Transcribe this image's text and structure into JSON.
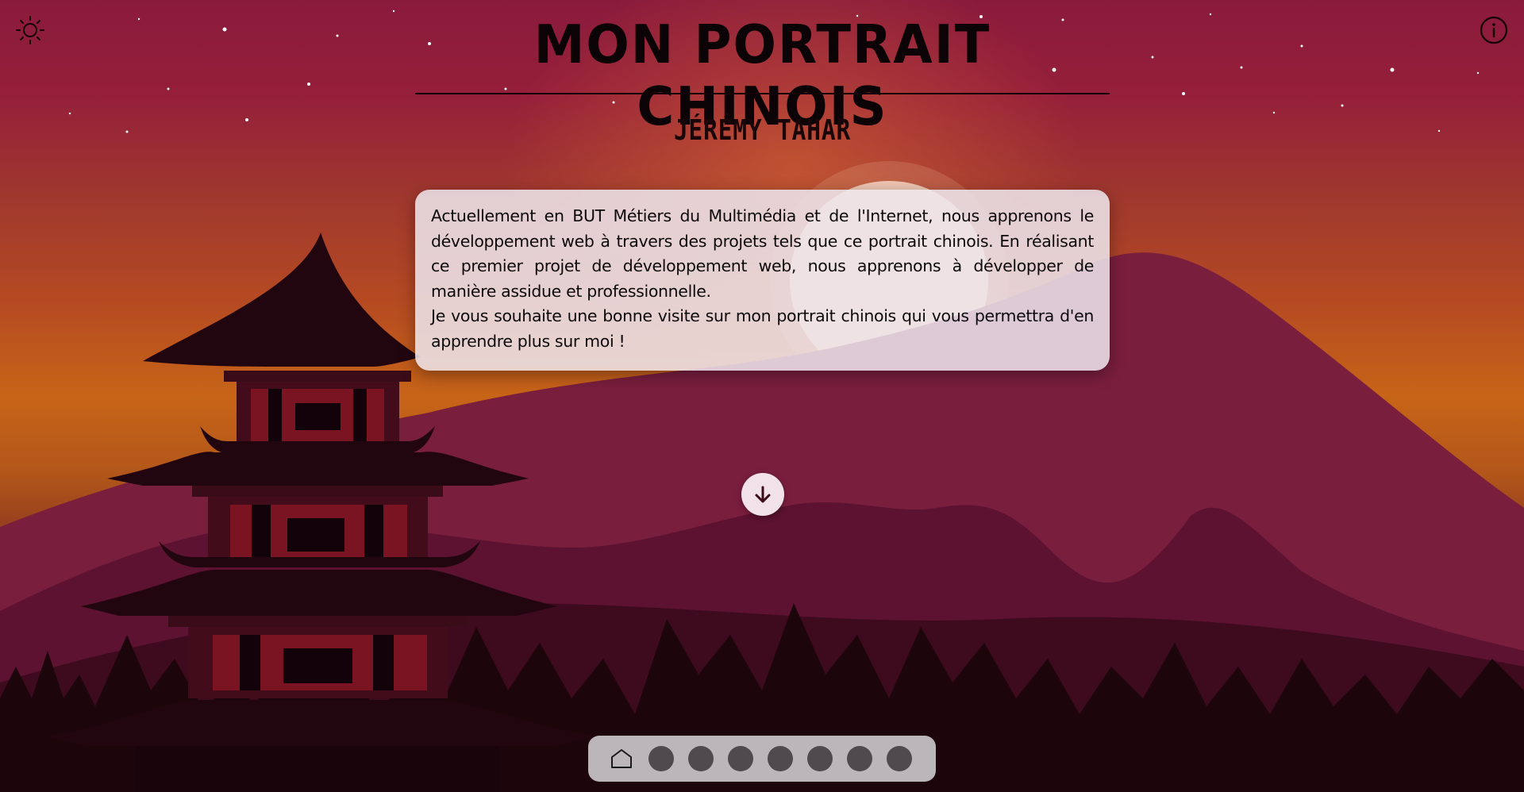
{
  "page": {
    "title": "MON PORTRAIT CHINOIS",
    "subtitle": "JÉRÉMY TAHAR"
  },
  "intro": {
    "paragraph1": "Actuellement en BUT Métiers du Multimédia et de l'Internet, nous apprenons le développement web à travers des projets tels que ce portrait chinois. En réalisant ce premier projet de développement web, nous apprenons à développer de manière assidue et professionnelle.",
    "paragraph2": "Je vous souhaite une bonne visite sur mon portrait chinois qui vous permettra d'en apprendre plus sur moi !"
  },
  "controls": {
    "theme_icon": "sun-icon",
    "info_icon": "info-icon",
    "scroll_icon": "arrow-down-icon"
  },
  "nav": {
    "home_icon": "home-icon",
    "dots": [
      1,
      2,
      3,
      4,
      5,
      6,
      7
    ]
  },
  "colors": {
    "sky_top": "#8a1a3c",
    "sky_mid": "#c76418",
    "mountain": "#6e1a3a",
    "silhouette": "#1d050c",
    "card_bg": "#eee6ee",
    "nav_bg": "#bab6ba",
    "nav_dot": "#4e4a4e"
  }
}
